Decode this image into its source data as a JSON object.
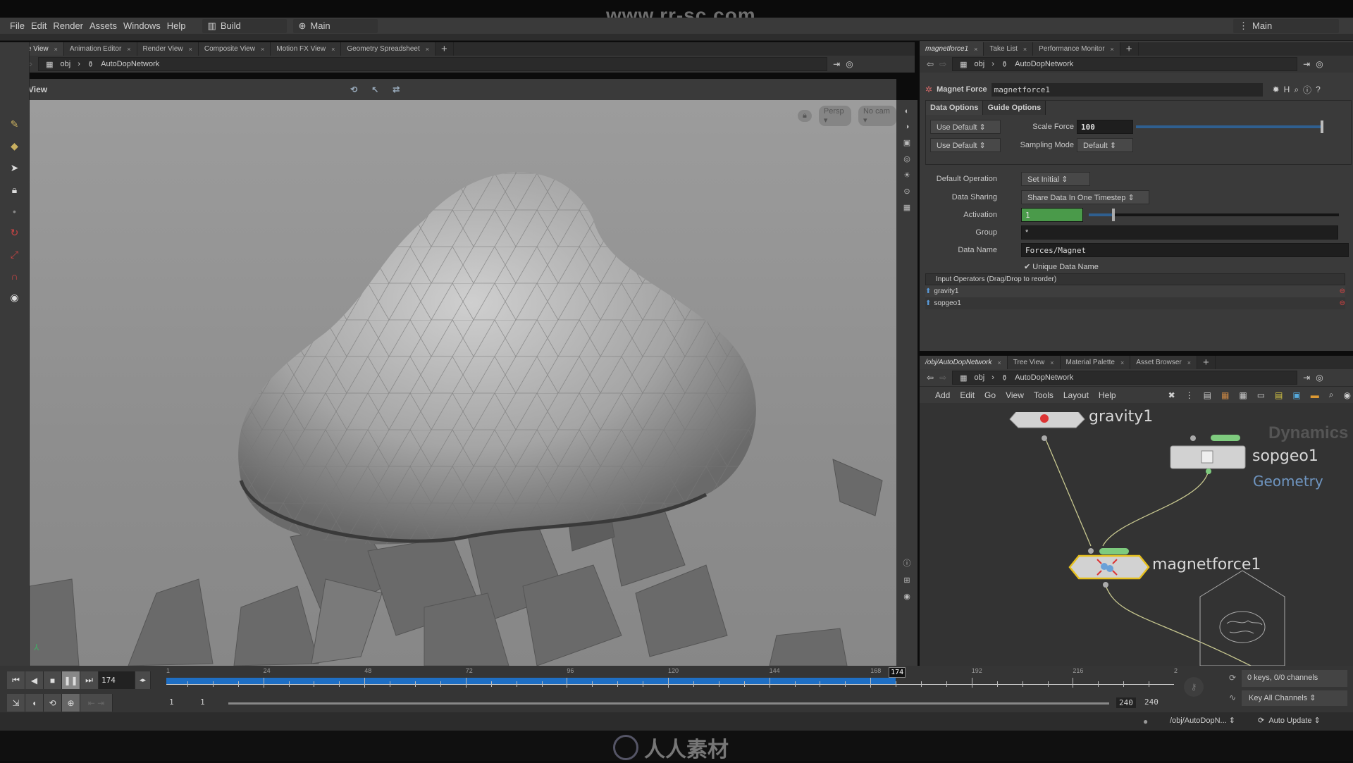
{
  "watermark": "www.rr-sc.com",
  "bottom_logo": "人人素材",
  "menu": {
    "items": [
      "File",
      "Edit",
      "Render",
      "Assets",
      "Windows",
      "Help"
    ],
    "desktop": "Build",
    "context": "Main",
    "right_context": "Main"
  },
  "scene_tabs": [
    "Scene View",
    "Animation Editor",
    "Render View",
    "Composite View",
    "Motion FX View",
    "Geometry Spreadsheet"
  ],
  "scene_path": [
    "obj",
    "AutoDopNetwork"
  ],
  "view": {
    "title": "View",
    "persp": "Persp",
    "camera": "No cam"
  },
  "param_tabs": [
    "magnetforce1",
    "Take List",
    "Performance Monitor"
  ],
  "param_path": [
    "obj",
    "AutoDopNetwork"
  ],
  "params": {
    "node_type": "Magnet Force",
    "node_name": "magnetforce1",
    "subtabs": [
      "Data Options",
      "Guide Options"
    ],
    "use_default_1": "Use Default",
    "use_default_2": "Use Default",
    "scale_force_label": "Scale Force",
    "scale_force": "100",
    "scale_force_fraction": 1.0,
    "sampling_mode_label": "Sampling Mode",
    "sampling_mode": "Default",
    "default_operation_label": "Default Operation",
    "default_operation": "Set Initial",
    "data_sharing_label": "Data Sharing",
    "data_sharing": "Share Data In One Timestep",
    "activation_label": "Activation",
    "activation": "1",
    "group_label": "Group",
    "group": "*",
    "data_name_label": "Data Name",
    "data_name": "Forces/Magnet",
    "unique_label": "Unique Data Name",
    "unique_checked": true,
    "inputs_header": "Input Operators (Drag/Drop to reorder)",
    "inputs": [
      "gravity1",
      "sopgeo1"
    ]
  },
  "net_tabs": [
    "/obj/AutoDopNetwork",
    "Tree View",
    "Material Palette",
    "Asset Browser"
  ],
  "net_path": [
    "obj",
    "AutoDopNetwork"
  ],
  "net_menu": [
    "Add",
    "Edit",
    "Go",
    "View",
    "Tools",
    "Layout",
    "Help"
  ],
  "network": {
    "context_label": "Dynamics",
    "nodes": {
      "gravity": "gravity1",
      "sopgeo": "sopgeo1",
      "sopgeo_comment": "Geometry",
      "magnet": "magnetforce1"
    }
  },
  "timeline": {
    "current": "174",
    "start": 1,
    "end": 240,
    "ticks": [
      "1",
      "24",
      "48",
      "72",
      "96",
      "120",
      "144",
      "168",
      "192",
      "216",
      "2"
    ],
    "range_start": "1",
    "range_start2": "1",
    "range_end": "240",
    "range_end2": "240",
    "keys_info": "0 keys, 0/0 channels",
    "key_mode": "Key All Channels"
  },
  "status": {
    "path": "/obj/AutoDopN...",
    "update": "Auto Update"
  },
  "colors": {
    "accent": "#1f6fc4",
    "activation_green": "#4a9a4a",
    "selected_node": "#e6c020",
    "wire": "#c8c890",
    "geometry_text": "#6f95c0"
  }
}
